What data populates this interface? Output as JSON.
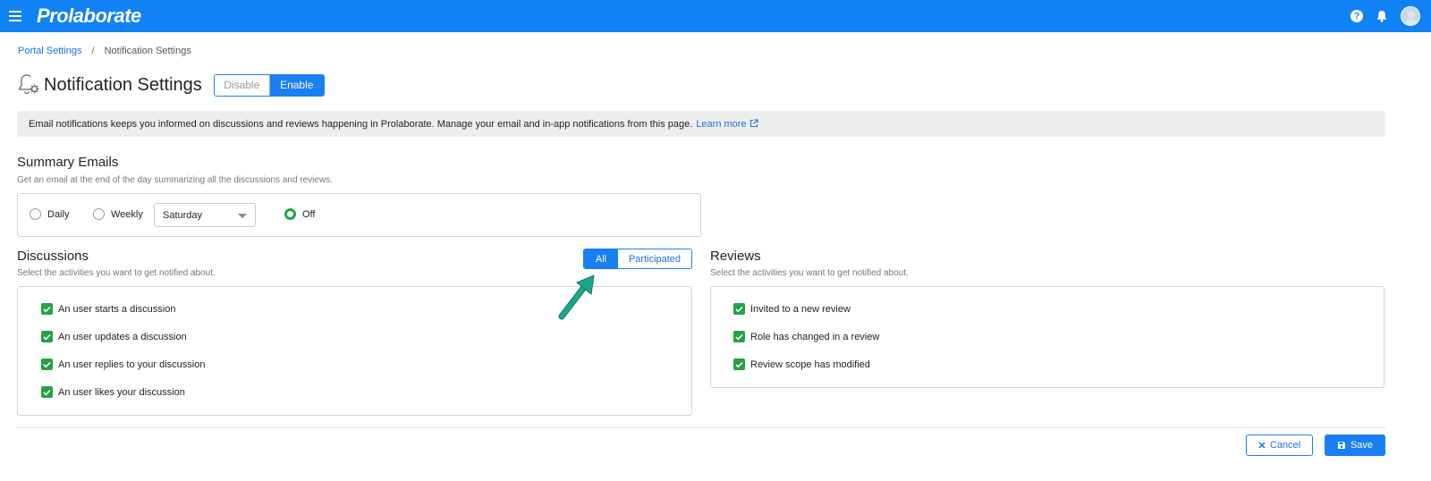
{
  "app": {
    "name": "Prolaborate"
  },
  "topbar": {
    "icons": [
      "menu-icon",
      "help-icon",
      "bell-icon",
      "user-avatar"
    ]
  },
  "breadcrumb": {
    "parent": "Portal Settings",
    "separator": "/",
    "current": "Notification Settings"
  },
  "page": {
    "title": "Notification Settings",
    "toggle": {
      "disable_label": "Disable",
      "enable_label": "Enable",
      "selected": "Enable"
    }
  },
  "banner": {
    "text": "Email notifications keeps you informed on discussions and reviews happening in Prolaborate. Manage your email and in-app notifications from this page.",
    "link_label": "Learn more"
  },
  "summary": {
    "title": "Summary Emails",
    "subtitle": "Get an email at the end of the day summarizing all the discussions and reviews.",
    "options": {
      "daily": "Daily",
      "weekly": "Weekly",
      "off": "Off"
    },
    "selected": "Off",
    "weekday": "Saturday"
  },
  "discussions": {
    "title": "Discussions",
    "subtitle": "Select the activities you want to get notified about.",
    "filter": {
      "all_label": "All",
      "participated_label": "Participated",
      "selected": "All"
    },
    "items": [
      {
        "label": "An user starts a discussion",
        "checked": true
      },
      {
        "label": "An user updates a discussion",
        "checked": true
      },
      {
        "label": "An user replies to your discussion",
        "checked": true
      },
      {
        "label": "An user likes your discussion",
        "checked": true
      }
    ]
  },
  "reviews": {
    "title": "Reviews",
    "subtitle": "Select the activities you want to get notified about.",
    "items": [
      {
        "label": "Invited to a new review",
        "checked": true
      },
      {
        "label": "Role has changed in a review",
        "checked": true
      },
      {
        "label": "Review scope has modified",
        "checked": true
      }
    ]
  },
  "footer": {
    "cancel_label": "Cancel",
    "save_label": "Save"
  },
  "colors": {
    "primary": "#1082f3",
    "checkbox": "#25a244",
    "annotation_arrow": "#1aa88a"
  }
}
